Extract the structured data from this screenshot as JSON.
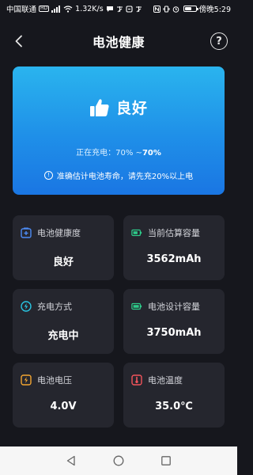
{
  "status_bar": {
    "carrier": "中国联通",
    "hd": "HD",
    "signal": "⁴ᴳ",
    "network_speed": "1.32K/s",
    "time": "傍晚5:29",
    "battery_level": 0.7
  },
  "header": {
    "title": "电池健康",
    "help_label": "?"
  },
  "health_card": {
    "status": "良好",
    "charge_prefix": "正在充电：70%",
    "charge_sep": "~",
    "charge_target": "70%",
    "tip": "准确估计电池寿命，请先充20%以上电",
    "info_glyph": "!"
  },
  "metrics": {
    "health": {
      "label": "电池健康度",
      "value": "良好"
    },
    "estimated_capacity": {
      "label": "当前估算容量",
      "value": "3562mAh"
    },
    "charge_mode": {
      "label": "充电方式",
      "value": "充电中"
    },
    "design_capacity": {
      "label": "电池设计容量",
      "value": "3750mAh"
    },
    "voltage": {
      "label": "电池电压",
      "value": "4.0V"
    },
    "temperature": {
      "label": "电池温度",
      "value": "35.0℃"
    }
  },
  "colors": {
    "background": "#16171d",
    "card": "#25262e",
    "health_card_top": "#2ab4ee",
    "health_card_bottom": "#1a76e3",
    "icon_blue": "#4d8cf5",
    "icon_green": "#2ecb8a",
    "icon_cyan": "#29c4e0",
    "icon_orange": "#f3a531",
    "icon_red": "#f2545b"
  }
}
